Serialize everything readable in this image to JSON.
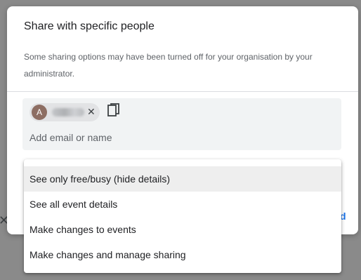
{
  "dialog": {
    "title": "Share with specific people",
    "notice": "Some sharing options may have been turned off for your organisation by your administrator."
  },
  "people": {
    "chip": {
      "avatar_letter": "A",
      "avatar_color": "#8d6e63",
      "remove_symbol": "✕"
    },
    "input_placeholder": "Add email or name",
    "copy_icon": "content-copy-icon"
  },
  "background": {
    "close_symbol": "✕",
    "link_fragment": "d"
  },
  "permission_menu": {
    "selected_index": 0,
    "items": [
      "See only free/busy (hide details)",
      "See all event details",
      "Make changes to events",
      "Make changes and manage sharing"
    ]
  },
  "colors": {
    "accent": "#1a73e8",
    "overlay": "#8a8a8a",
    "input_bg": "#f1f3f4",
    "selected_item_bg": "#eeeeee"
  }
}
